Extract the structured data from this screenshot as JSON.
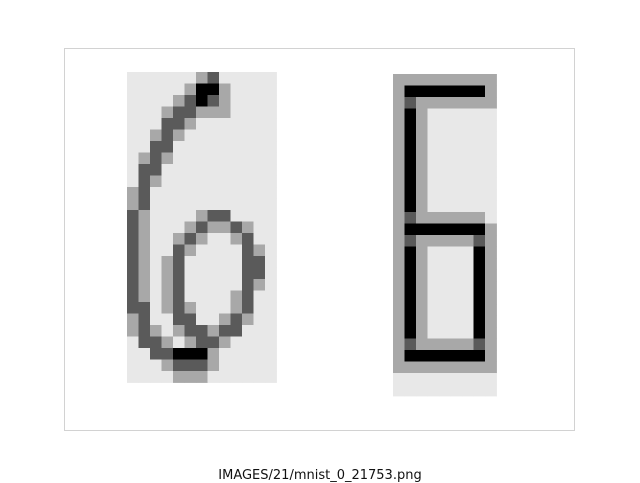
{
  "figure": {
    "caption": "IMAGES/21/mnist_0_21753.png",
    "panels": [
      {
        "name": "handwritten-digit",
        "depicts": "6"
      },
      {
        "name": "seven-segment-style-digit",
        "depicts": "6"
      }
    ],
    "colors": {
      "ink_dark": "#000000",
      "ink_mid": "#5a5a5a",
      "ink_light": "#a8a8a8",
      "ink_faint": "#e8e8e8",
      "frame": "#d2d2d2"
    }
  }
}
